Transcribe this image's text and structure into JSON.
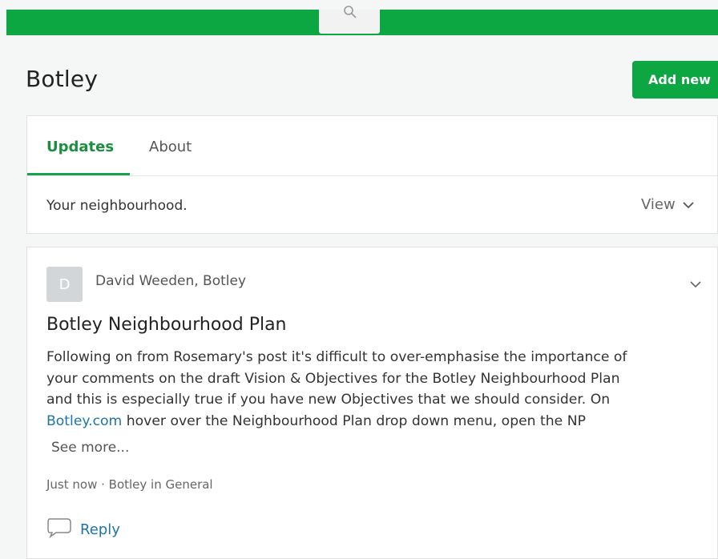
{
  "header": {
    "search_icon": "search-icon",
    "brand_color": "#0ca742"
  },
  "page": {
    "title": "Botley",
    "add_new_label": "Add new"
  },
  "tabs": [
    {
      "label": "Updates",
      "active": true
    },
    {
      "label": "About",
      "active": false
    }
  ],
  "filter": {
    "text": "Your neighbourhood.",
    "view_label": "View",
    "view_icon": "chevron-down-icon"
  },
  "post": {
    "avatar_initial": "D",
    "author": "David Weeden, Botley",
    "title": "Botley Neighbourhood Plan",
    "body_line1": "Following on from Rosemary's post it's difficult to over-emphasise the importance of",
    "body_line2": "your comments on the draft Vision & Objectives for the Botley Neighbourhood Plan",
    "body_line3": "and this is especially true if you have new Objectives that we should consider. On",
    "body_link": "Botley.com",
    "body_line4_rest": " hover over the Neighbourhood Plan drop down menu, open the NP",
    "see_more": "See more...",
    "meta": "Just now · Botley in General",
    "reply_label": "Reply",
    "link_color": "#1f74a8"
  }
}
